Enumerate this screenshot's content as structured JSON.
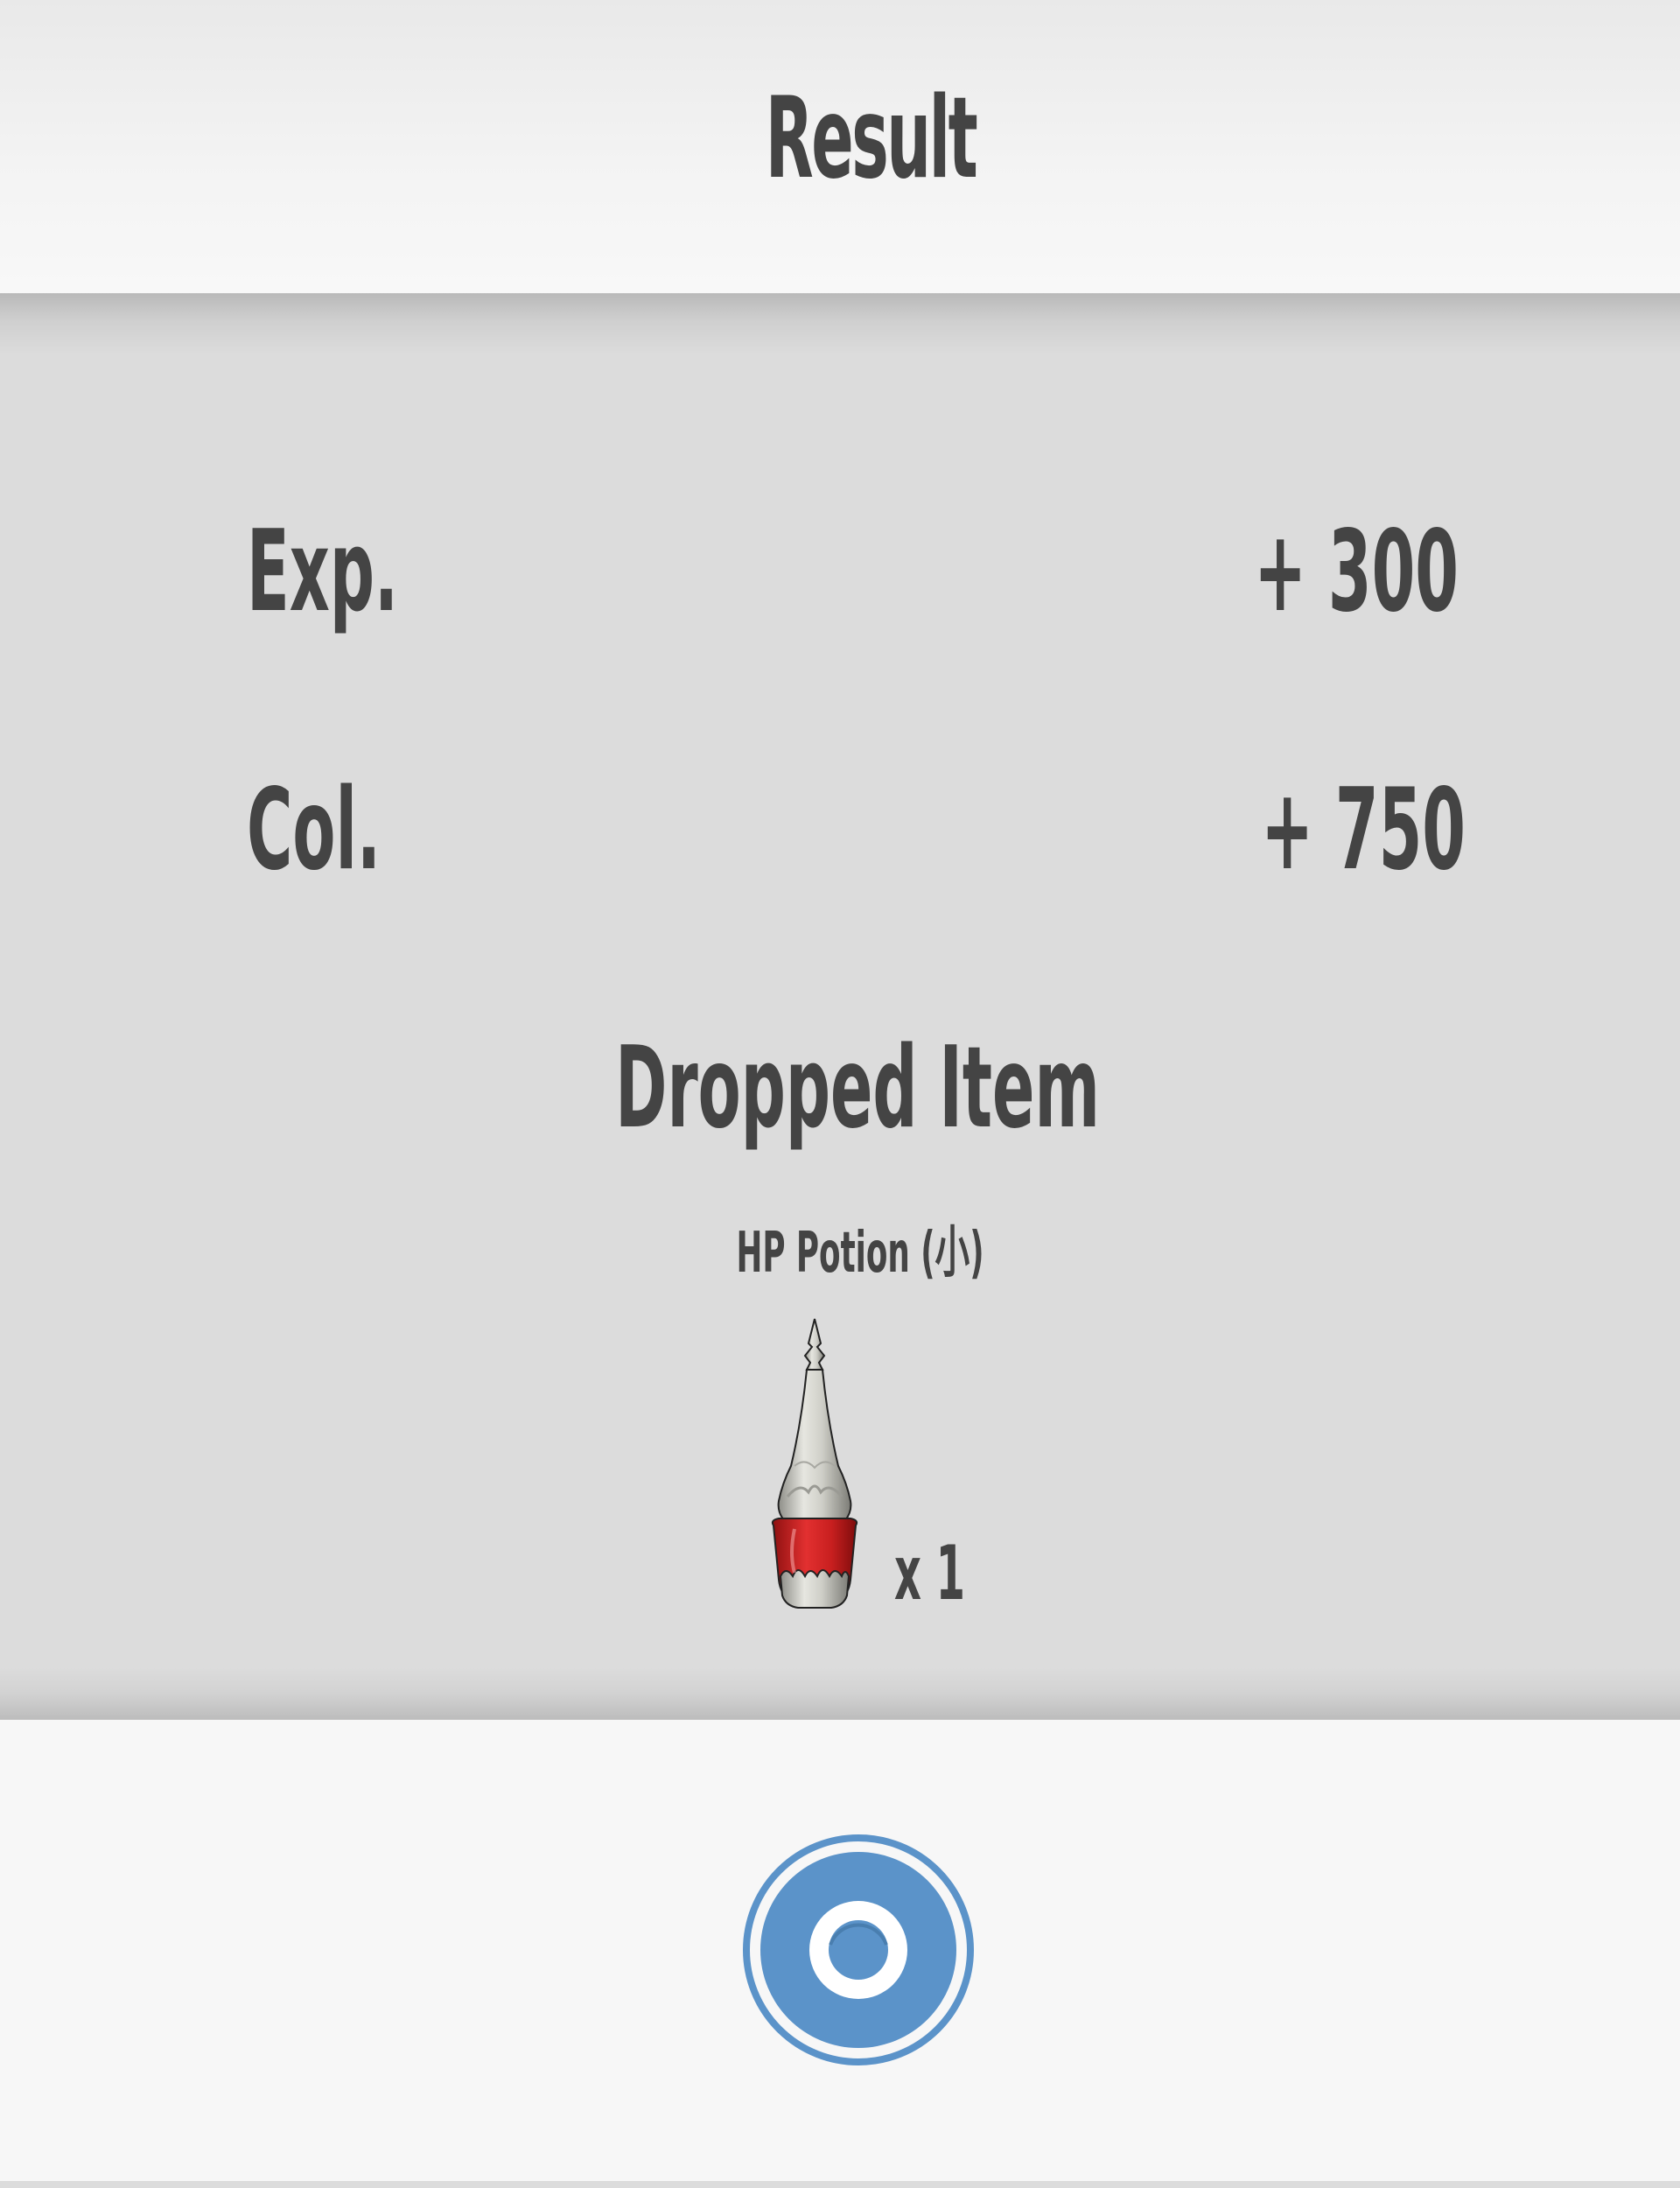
{
  "header": {
    "title": "Result"
  },
  "stats": {
    "exp": {
      "label": "Exp.",
      "value": "+ 300"
    },
    "col": {
      "label": "Col.",
      "value": "+ 750"
    }
  },
  "drop": {
    "title": "Dropped Item",
    "item_name": "HP Potion (小)",
    "quantity": "x 1",
    "icon": "potion-bottle-icon"
  },
  "footer": {
    "confirm_icon": "circle-confirm-icon"
  },
  "colors": {
    "text": "#444444",
    "header_bg": "#f3f3f3",
    "panel_bg": "#dcdcdc",
    "footer_bg": "#f7f7f7",
    "button_blue": "#5b93c9",
    "potion_red": "#cc2222"
  }
}
